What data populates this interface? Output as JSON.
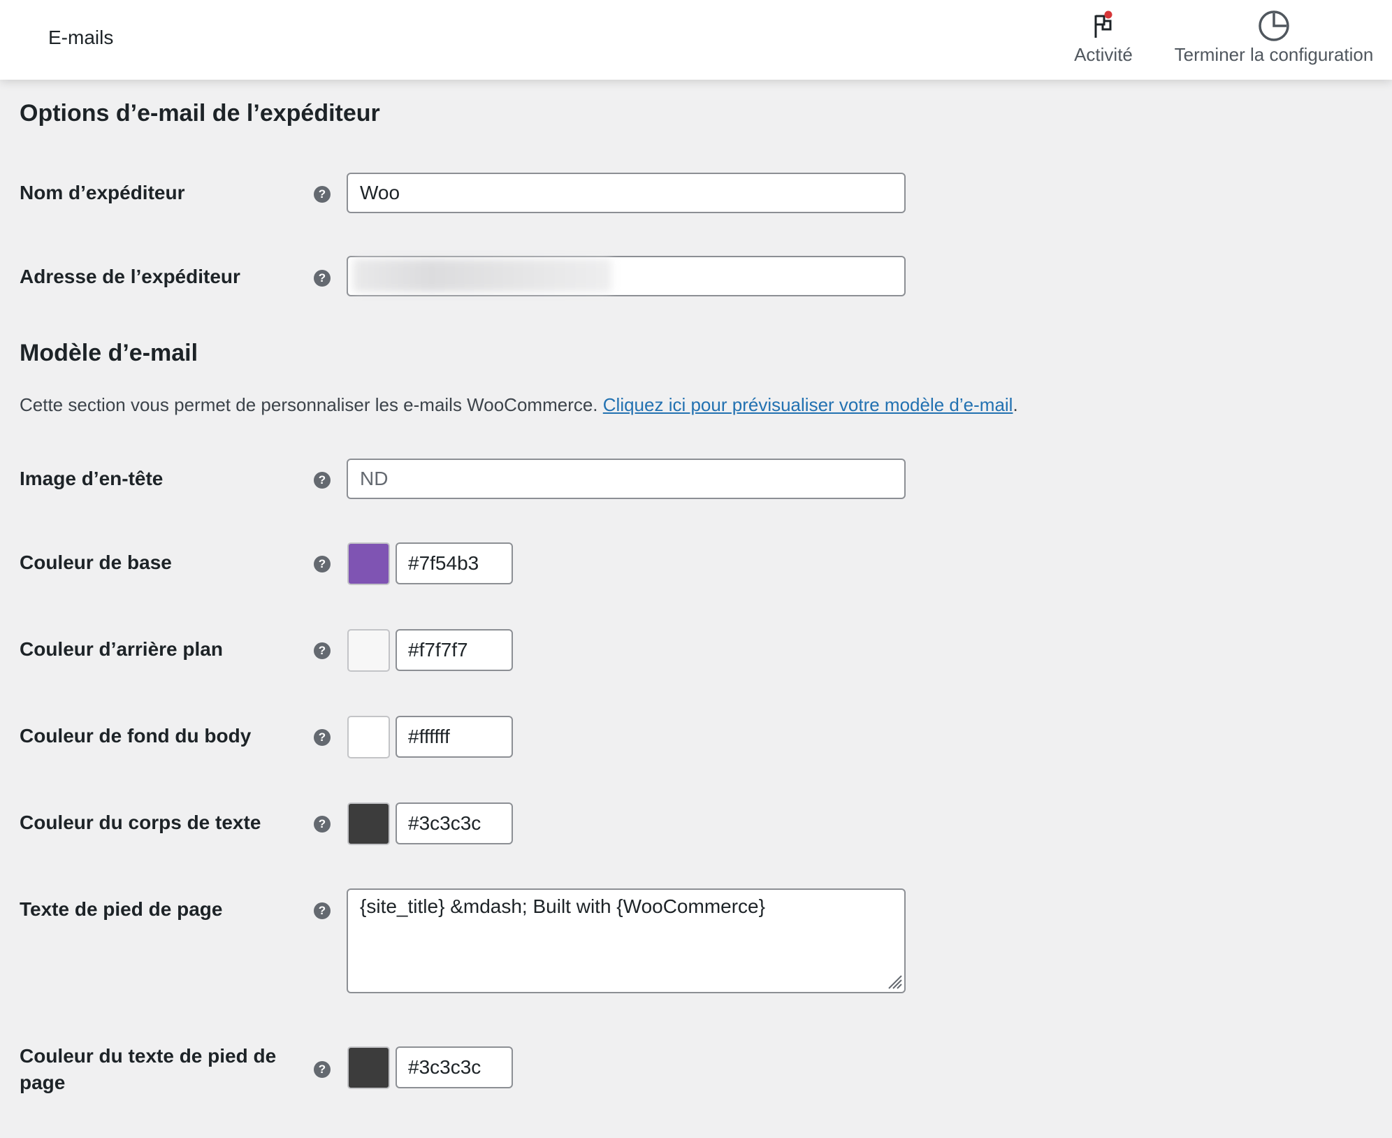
{
  "header": {
    "title": "E-mails",
    "activity_label": "Activité",
    "setup_label": "Terminer la configuration",
    "activity_icon": "flag-icon",
    "setup_icon": "progress-circle-icon",
    "notification_color": "#d63638"
  },
  "sender": {
    "title": "Options d’e-mail de l’expéditeur",
    "name_label": "Nom d’expéditeur",
    "name_value": "Woo",
    "address_label": "Adresse de l’expéditeur"
  },
  "template": {
    "title": "Modèle d’e-mail",
    "description": "Cette section vous permet de personnaliser les e-mails WooCommerce. ",
    "preview_link": "Cliquez ici pour prévisualiser votre modèle d’e-mail",
    "description_end": ".",
    "header_image_label": "Image d’en-tête",
    "header_image_placeholder": "ND",
    "base_color_label": "Couleur de base",
    "base_color": "#7f54b3",
    "background_color_label": "Couleur d’arrière plan",
    "background_color": "#f7f7f7",
    "body_background_label": "Couleur de fond du body",
    "body_background_color": "#ffffff",
    "body_text_label": "Couleur du corps de texte",
    "body_text_color": "#3c3c3c",
    "footer_text_label": "Texte de pied de page",
    "footer_text": "{site_title} &mdash; Built with {WooCommerce}",
    "footer_color_label": "Couleur du texte de pied de page",
    "footer_color": "#3c3c3c"
  },
  "help_glyph": "?"
}
